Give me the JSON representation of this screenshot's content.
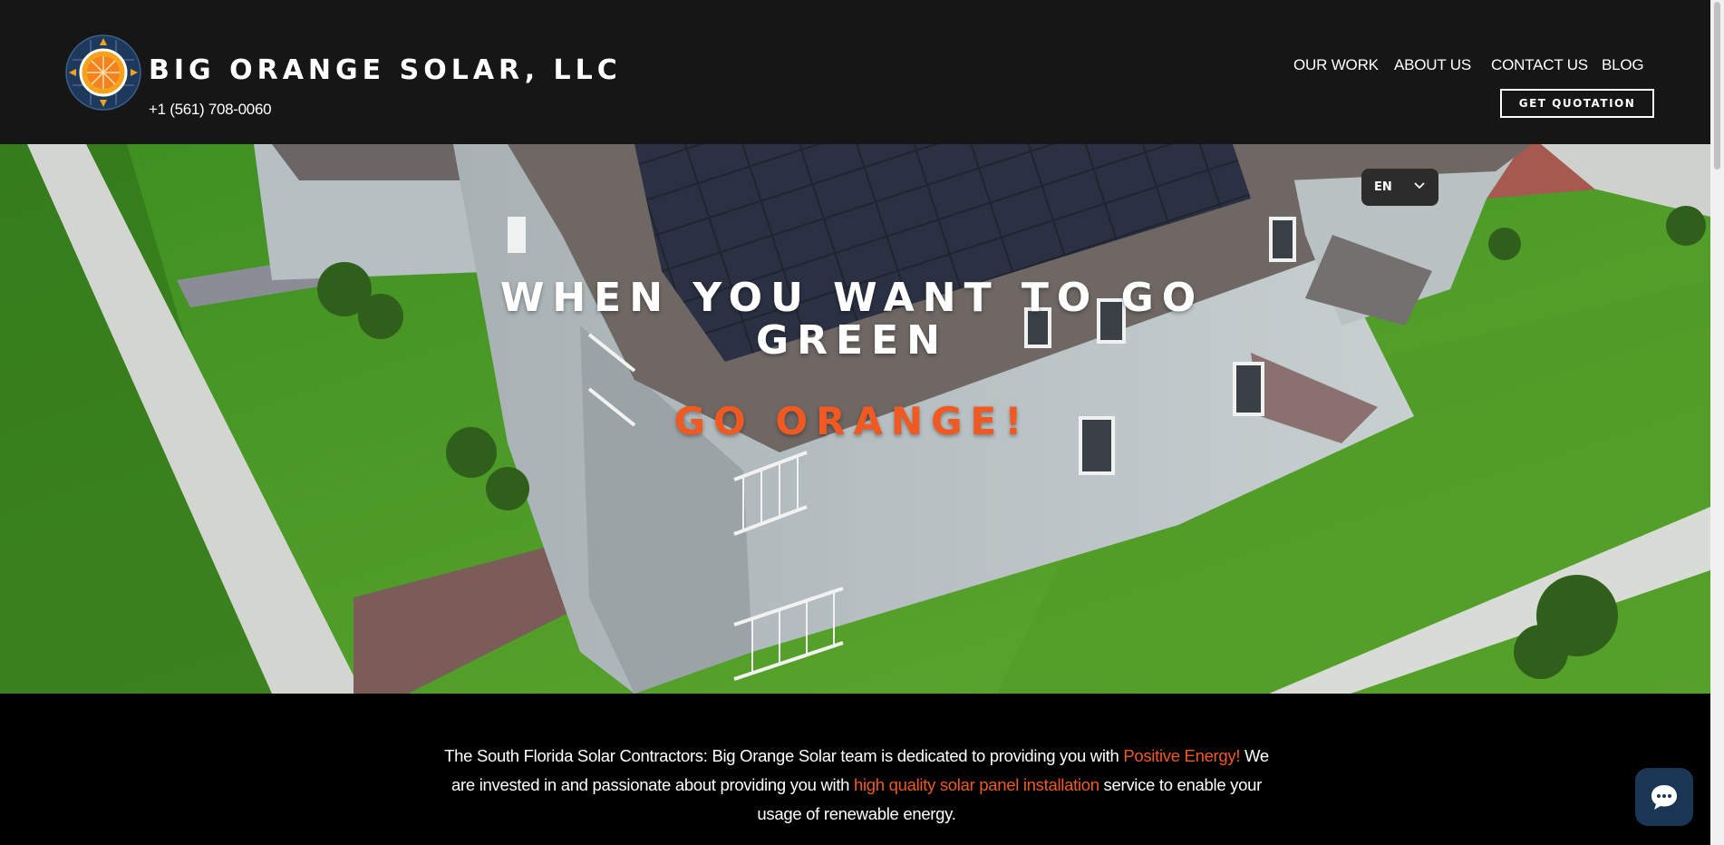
{
  "header": {
    "brand_name": "BIG ORANGE SOLAR, LLC",
    "phone": "+1 (561) 708-0060",
    "nav": [
      "OUR WORK",
      "ABOUT US",
      "CONTACT US",
      "BLOG"
    ],
    "cta_label": "GET QUOTATION",
    "logo_icon": "orange-sun-logo-icon"
  },
  "language": {
    "selected": "EN"
  },
  "hero": {
    "headline": "WHEN YOU WANT TO GO GREEN",
    "subline": "GO ORANGE!"
  },
  "intro": {
    "part1": "The South Florida Solar Contractors: Big Orange Solar team is dedicated to providing you with ",
    "highlight1": "Positive Energy!",
    "part2": " We are invested in and passionate about providing you with ",
    "highlight2": "high quality solar panel installation",
    "part3": " service to enable your usage of renewable energy."
  },
  "chat": {
    "icon": "chat-bubble-icon"
  },
  "colors": {
    "accent": "#f05a22",
    "header_bg": "#161616",
    "chat_bg": "#1b3554"
  }
}
